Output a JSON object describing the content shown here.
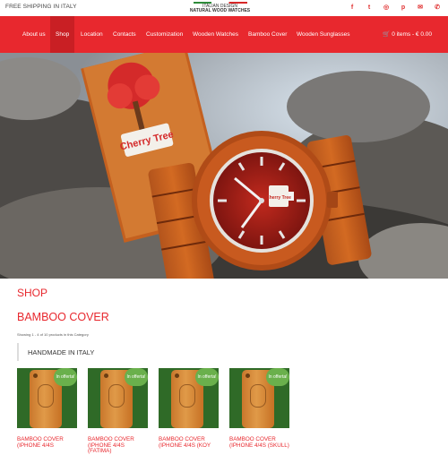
{
  "topbar": {
    "shipping": "FREE SHIPPING IN ITALY",
    "logo_line1": "ITALIAN DESIGN",
    "logo_line2": "NATURAL WOOD WATCHES",
    "socials": [
      "facebook-icon",
      "twitter-icon",
      "instagram-icon",
      "pinterest-icon",
      "email-icon",
      "phone-icon"
    ]
  },
  "nav": {
    "items": [
      "About us",
      "Shop",
      "Location",
      "Contacts",
      "Customization",
      "Wooden Watches",
      "Bamboo Cover",
      "Wooden Sunglasses"
    ],
    "active": "Shop",
    "cart": "0 items - € 0.00"
  },
  "hero": {
    "box_logo_text": "Cherry Tree",
    "watch_dial_text": "Cherry Tree"
  },
  "main": {
    "shop_title": "SHOP",
    "category_title": "BAMBOO COVER",
    "showing": "Showing 1 - 4 of 10 products in this Category",
    "subheading": "HANDMADE IN ITALY"
  },
  "products": [
    {
      "badge": "In offerta!",
      "title": "BAMBOO COVER (IPHONE 4/4S"
    },
    {
      "badge": "In offerta!",
      "title": "BAMBOO COVER (IPHONE 4/4S (FATIMA)"
    },
    {
      "badge": "In offerta!",
      "title": "BAMBOO COVER (IPHONE 4/4S (KOY"
    },
    {
      "badge": "In offerta!",
      "title": "BAMBOO COVER (IPHONE 4/4S (SKULL)"
    }
  ],
  "colors": {
    "accent": "#e8282e",
    "nav_active": "#c91f24",
    "badge": "#6ab04c"
  }
}
